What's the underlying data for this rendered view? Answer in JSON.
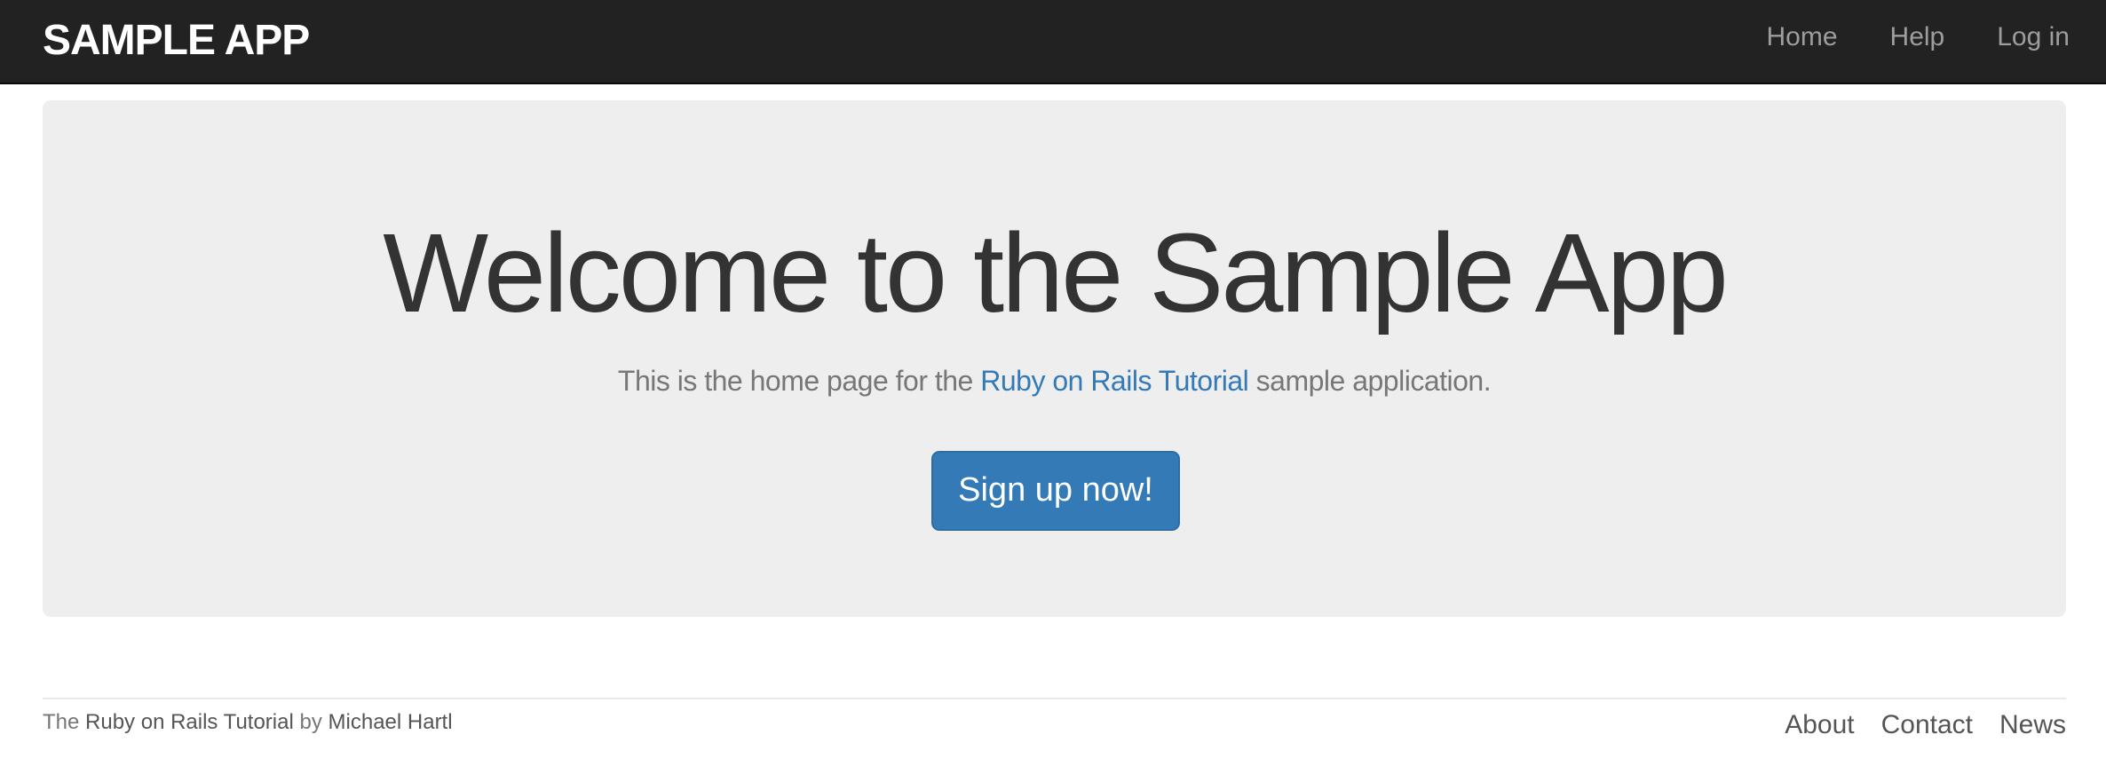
{
  "navbar": {
    "brand": "SAMPLE APP",
    "links": [
      "Home",
      "Help",
      "Log in"
    ]
  },
  "hero": {
    "title": "Welcome to the Sample App",
    "text_before": "This is the home page for the",
    "link_text": "Ruby on Rails Tutorial",
    "text_after": "sample application.",
    "button_label": "Sign up now!"
  },
  "footer": {
    "prefix": "The",
    "tutorial_link": "Ruby on Rails Tutorial",
    "by": "by",
    "author_link": "Michael Hartl",
    "links": [
      "About",
      "Contact",
      "News"
    ]
  },
  "colors": {
    "navbar_bg": "#222222",
    "brand": "#ffffff",
    "nav_link": "#9d9d9d",
    "jumbotron_bg": "#eeeeee",
    "accent": "#337ab7",
    "text": "#333333",
    "muted": "#777777"
  }
}
